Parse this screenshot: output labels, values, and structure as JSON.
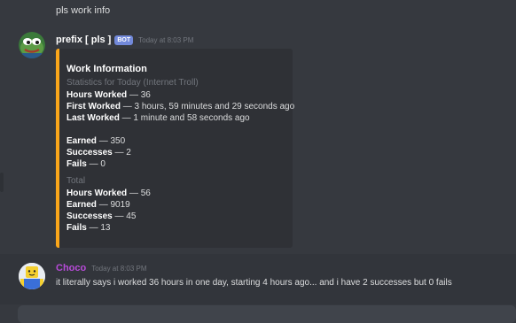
{
  "previous_message": {
    "text": "pls work info"
  },
  "bot_message": {
    "username": "prefix [ pls ]",
    "tag": "BOT",
    "timestamp": "Today at 8:03 PM",
    "username_color": "#ffffff",
    "embed": {
      "accent_color": "#faa61a",
      "title": "Work Information",
      "today_header": "Statistics for Today (Internet Troll)",
      "today": [
        {
          "label": "Hours Worked",
          "value": "36"
        },
        {
          "label": "First Worked",
          "value": "3 hours, 59 minutes and 29 seconds ago"
        },
        {
          "label": "Last Worked",
          "value": "1 minute and 58 seconds ago"
        }
      ],
      "today_counts": [
        {
          "label": "Earned",
          "value": "350"
        },
        {
          "label": "Successes",
          "value": "2"
        },
        {
          "label": "Fails",
          "value": "0"
        }
      ],
      "total_header": "Total",
      "total": [
        {
          "label": "Hours Worked",
          "value": "56"
        },
        {
          "label": "Earned",
          "value": "9019"
        },
        {
          "label": "Successes",
          "value": "45"
        },
        {
          "label": "Fails",
          "value": "13"
        }
      ]
    }
  },
  "user_message": {
    "username": "Choco",
    "username_color": "#b84bd9",
    "timestamp": "Today at 8:03 PM",
    "text": "it literally says i worked 36 hours in one day, starting 4 hours ago... and i have 2 successes but 0 fails"
  },
  "separator": "—",
  "colors": {
    "background": "#36393f",
    "embed_background": "#2f3136",
    "bot_tag": "#7289da"
  }
}
